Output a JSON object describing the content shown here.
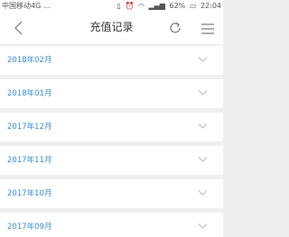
{
  "status_bar": {
    "carrier": "中国移动4G …",
    "battery_percent": "62%",
    "time": "22:04"
  },
  "nav": {
    "title": "充值记录",
    "back_icon": "back-arrow-icon",
    "refresh_icon": "refresh-icon",
    "menu_icon": "menu-icon"
  },
  "records": {
    "months": [
      {
        "label": "2018年02月"
      },
      {
        "label": "2018年01月"
      },
      {
        "label": "2017年12月"
      },
      {
        "label": "2017年11月"
      },
      {
        "label": "2017年10月"
      },
      {
        "label": "2017年09月"
      }
    ]
  },
  "colors": {
    "accent": "#3a8ed6",
    "background": "#efefef"
  }
}
